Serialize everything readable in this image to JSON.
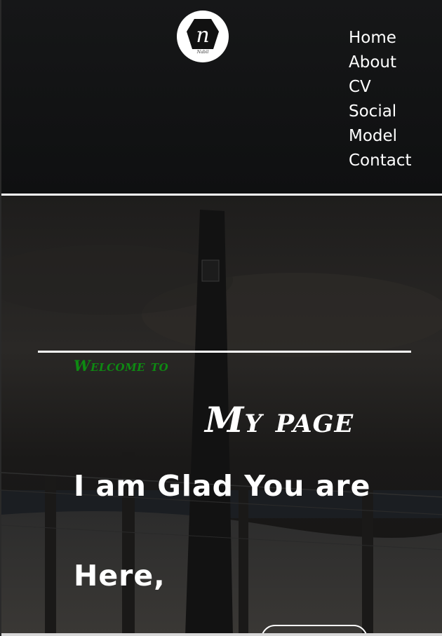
{
  "header": {
    "logo": {
      "icon": "n-hexagon-logo",
      "letter": "n",
      "caption": "Nabil"
    },
    "nav": {
      "items": [
        {
          "label": "Home"
        },
        {
          "label": "About"
        },
        {
          "label": "CV"
        },
        {
          "label": "Social"
        },
        {
          "label": "Model"
        },
        {
          "label": "Contact"
        }
      ]
    }
  },
  "hero": {
    "welcome": "Welcome to",
    "title": "My page",
    "line1": "I am Glad You are",
    "line2": "Here,",
    "colors": {
      "welcome": "#0e8a12",
      "text": "#ffffff"
    }
  }
}
